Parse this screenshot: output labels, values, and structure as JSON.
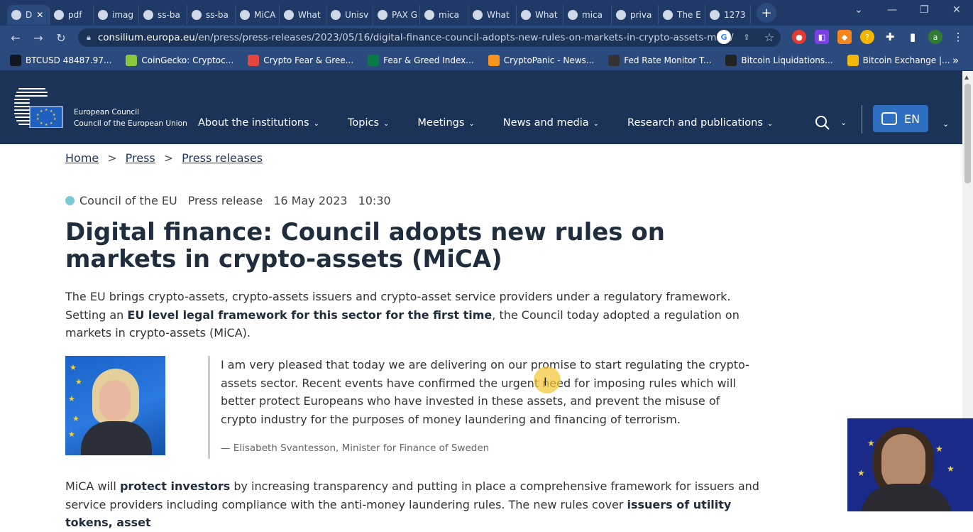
{
  "browser": {
    "tabs": [
      {
        "label": "D",
        "active": true
      },
      {
        "label": "pdf"
      },
      {
        "label": "imag"
      },
      {
        "label": "ss-ba"
      },
      {
        "label": "ss-ba"
      },
      {
        "label": "MiCA"
      },
      {
        "label": "What"
      },
      {
        "label": "Unisv"
      },
      {
        "label": "PAX G"
      },
      {
        "label": "mica"
      },
      {
        "label": "What"
      },
      {
        "label": "What"
      },
      {
        "label": "mica"
      },
      {
        "label": "priva"
      },
      {
        "label": "The E"
      },
      {
        "label": "1273"
      }
    ],
    "tab_close": "✕",
    "new_tab": "+",
    "url_host": "consilium.europa.eu",
    "url_path": "/en/press/press-releases/2023/05/16/digital-finance-council-adopts-new-rules-on-markets-in-crypto-assets-mica/",
    "bookmarks": [
      {
        "label": "BTCUSD 48487.97...",
        "color": "#131722"
      },
      {
        "label": "CoinGecko: Cryptoc...",
        "color": "#8dc63f"
      },
      {
        "label": "Crypto Fear & Gree...",
        "color": "#e2483d"
      },
      {
        "label": "Fear & Greed Index...",
        "color": "#0a7b48"
      },
      {
        "label": "CryptoPanic - News...",
        "color": "#f7931a"
      },
      {
        "label": "Fed Rate Monitor T...",
        "color": "#333333"
      },
      {
        "label": "Bitcoin Liquidations...",
        "color": "#222222"
      },
      {
        "label": "Bitcoin Exchange |...",
        "color": "#f0b90b"
      }
    ],
    "bookmarks_more": "»"
  },
  "site": {
    "logo_line1": "European Council",
    "logo_line2": "Council of the European Union",
    "nav": [
      {
        "label": "About the institutions"
      },
      {
        "label": "Topics"
      },
      {
        "label": "Meetings"
      },
      {
        "label": "News and media"
      },
      {
        "label": "Research and publications"
      }
    ],
    "language": "EN"
  },
  "breadcrumb": [
    {
      "label": "Home"
    },
    {
      "label": "Press"
    },
    {
      "label": "Press releases"
    }
  ],
  "breadcrumb_sep": ">",
  "meta": {
    "institution": "Council of the EU",
    "type": "Press release",
    "date": "16 May 2023",
    "time": "10:30"
  },
  "article": {
    "title": "Digital finance: Council adopts new rules on markets in crypto-assets (MiCA)",
    "lead_1": "The EU brings crypto-assets, crypto-assets issuers and crypto-asset service providers under a regulatory framework. Setting an ",
    "lead_bold": "EU level legal framework for this sector for the first time",
    "lead_2": ", the Council today adopted a regulation on markets in crypto-assets (MiCA).",
    "quote": "I am very pleased that today we are delivering on our promise to start regulating the crypto-assets sector. Recent events have confirmed the urgent need for imposing rules which will better protect Europeans who have invested in these assets, and prevent the misuse of crypto industry for the purposes of money laundering and financing of terrorism.",
    "quote_attribution": "— Elisabeth Svantesson, Minister for Finance of Sweden",
    "body_1": "MiCA will ",
    "body_bold_1": "protect investors",
    "body_2": " by increasing transparency and putting in place a comprehensive framework for issuers and service providers including compliance with the anti-money laundering rules. The new rules cover ",
    "body_bold_2": "issuers of utility tokens, asset"
  }
}
